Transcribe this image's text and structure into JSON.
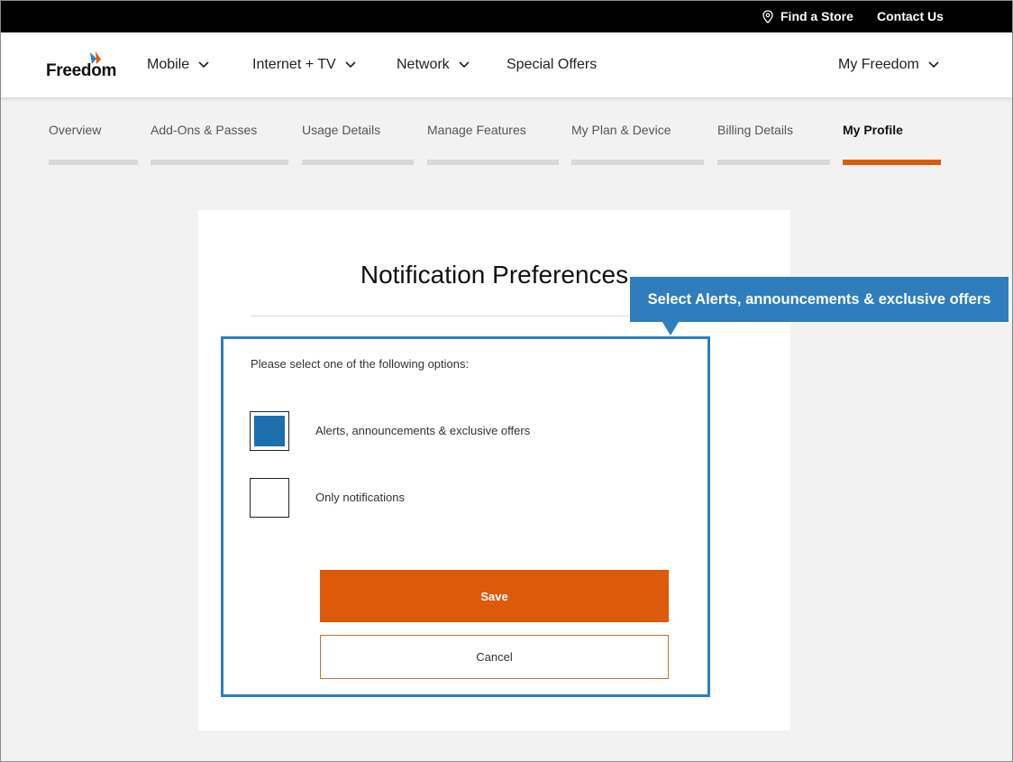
{
  "utility": {
    "find_store": "Find a Store",
    "contact_us": "Contact Us"
  },
  "brand": {
    "logo_text": "Freedom",
    "logo_colors": [
      "#dd5a0b",
      "#2f7dbd"
    ]
  },
  "nav": {
    "mobile": "Mobile",
    "internet_tv": "Internet + TV",
    "network": "Network",
    "special_offers": "Special Offers",
    "my_freedom": "My Freedom"
  },
  "subtabs": [
    {
      "label": "Overview"
    },
    {
      "label": "Add-Ons & Passes"
    },
    {
      "label": "Usage Details"
    },
    {
      "label": "Manage Features"
    },
    {
      "label": "My Plan & Device"
    },
    {
      "label": "Billing Details"
    },
    {
      "label": "My Profile",
      "active": true
    }
  ],
  "card": {
    "title": "Notification Preferences",
    "prompt": "Please select one of the following options:",
    "options": [
      {
        "label": "Alerts, announcements & exclusive offers",
        "checked": true
      },
      {
        "label": "Only notifications",
        "checked": false
      }
    ],
    "save_label": "Save",
    "cancel_label": "Cancel"
  },
  "callout": {
    "text": "Select Alerts, announcements & exclusive offers"
  },
  "colors": {
    "accent": "#dd5a0b",
    "highlight": "#2f7dbd",
    "checked_fill": "#1c6fad"
  }
}
